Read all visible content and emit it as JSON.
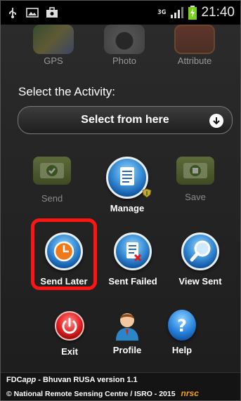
{
  "status_bar": {
    "icons_left": [
      "usb-icon",
      "image-icon",
      "bag-icon"
    ],
    "network": "3G",
    "time": "21:40"
  },
  "top_row": {
    "items": [
      {
        "label": "GPS",
        "icon": "map-icon"
      },
      {
        "label": "Photo",
        "icon": "camera-icon"
      },
      {
        "label": "Attribute",
        "icon": "tag-icon"
      }
    ]
  },
  "activity": {
    "label": "Select the Activity:",
    "select_value": "Select from here"
  },
  "grid": {
    "send": "Send",
    "manage": "Manage",
    "save": "Save",
    "send_later": "Send Later",
    "sent_failed": "Sent Failed",
    "view_sent": "View Sent",
    "exit": "Exit",
    "profile": "Profile",
    "help": "Help"
  },
  "footer": {
    "app_prefix": "FDC",
    "app_italic": "app",
    "version_text": " - Bhuvan RUSA version 1.1",
    "copyright": "© National Remote Sensing Centre / ISRO - 2015",
    "logo_text": "nrsc"
  },
  "colors": {
    "highlight": "#ff1414",
    "orb_blue": "#3a8fd6",
    "orb_red": "#e42222",
    "nrsc_orange": "#f2a020"
  }
}
